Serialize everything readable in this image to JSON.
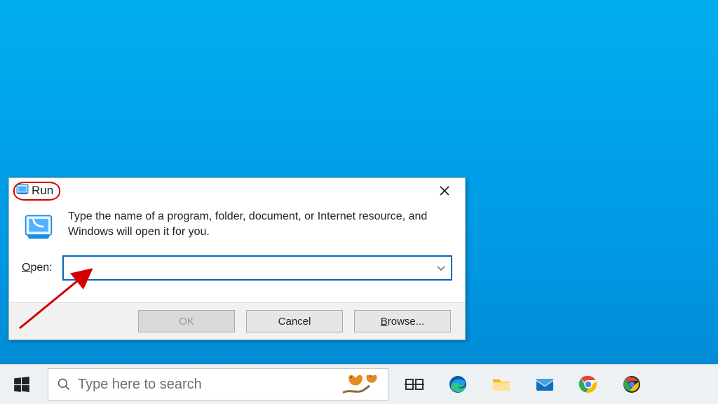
{
  "run_dialog": {
    "title": "Run",
    "description": "Type the name of a program, folder, document, or Internet resource, and Windows will open it for you.",
    "open_label_pre": "O",
    "open_label_post": "pen:",
    "input_value": "",
    "buttons": {
      "ok": "OK",
      "cancel": "Cancel",
      "browse": "Browse..."
    }
  },
  "taskbar": {
    "search_placeholder": "Type here to search"
  }
}
